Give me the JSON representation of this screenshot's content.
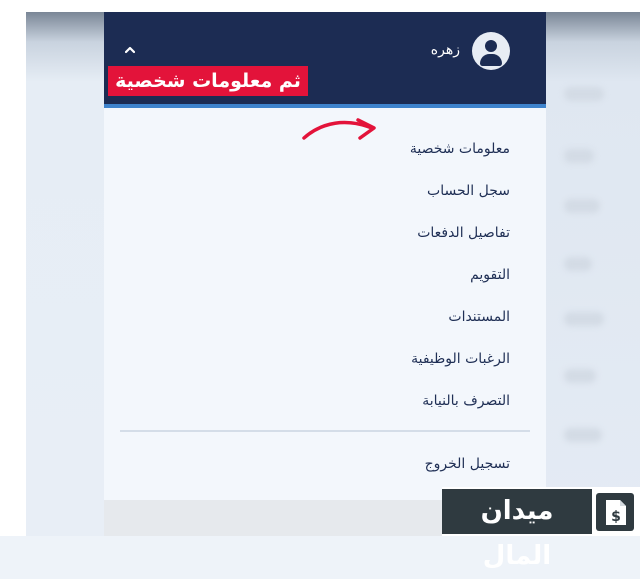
{
  "header": {
    "user_name": "زهره",
    "caption": "ثم معلومات شخصية"
  },
  "menu": {
    "items": [
      "معلومات شخصية",
      "سجل الحساب",
      "تفاصيل الدفعات",
      "التقويم",
      "المستندات",
      "الرغبات الوظيفية",
      "التصرف بالنيابة"
    ],
    "logout": "تسجيل الخروج"
  },
  "logo": {
    "text": "ميدان المال"
  },
  "colors": {
    "header_bg": "#1c2c53",
    "accent_line": "#3e83cc",
    "caption_bg": "#e3133a",
    "arrow": "#e3133a",
    "menu_text": "#1f2f55",
    "logo_bg": "#2f3a40"
  },
  "icons": {
    "avatar": "user-avatar-icon",
    "chevron": "chevron-up-icon",
    "arrow": "red-curved-arrow-icon",
    "logo": "document-dollar-icon"
  }
}
